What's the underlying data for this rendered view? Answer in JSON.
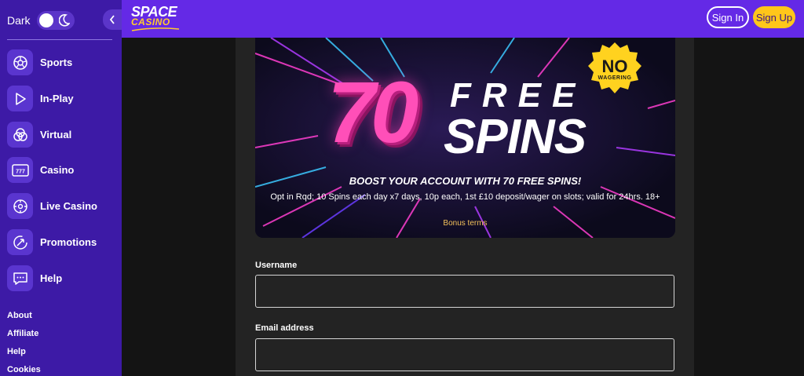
{
  "sidebar": {
    "dark_label": "Dark",
    "theme_toggle": {
      "icon": "moon-icon",
      "enabled": true
    },
    "collapse_icon": "chevron-left-icon",
    "nav_items": [
      {
        "label": "Sports",
        "icon": "sports-ball-icon"
      },
      {
        "label": "In-Play",
        "icon": "play-icon"
      },
      {
        "label": "Virtual",
        "icon": "virtual-icon"
      },
      {
        "label": "Casino",
        "icon": "slot-777-icon"
      },
      {
        "label": "Live Casino",
        "icon": "roulette-icon"
      },
      {
        "label": "Promotions",
        "icon": "promotion-icon"
      },
      {
        "label": "Help",
        "icon": "chat-help-icon"
      }
    ],
    "footer_links": [
      "About",
      "Affiliate",
      "Help",
      "Cookies"
    ]
  },
  "header": {
    "logo_top": "SPACE",
    "logo_bottom": "CASINO",
    "signin_label": "Sign In",
    "signup_label": "Sign Up"
  },
  "banner": {
    "number": "70",
    "free": "FREE",
    "spins": "SPINS",
    "badge_top": "NO",
    "badge_bottom": "WAGERING",
    "headline": "BOOST YOUR ACCOUNT WITH 70 FREE SPINS!",
    "terms": "Opt in Rqd; 10 Spins each day x7 days, 10p each, 1st £10 deposit/wager on slots; valid for 24hrs. 18+",
    "bonus_terms_link": "Bonus terms"
  },
  "form": {
    "username_label": "Username",
    "username_value": "",
    "email_label": "Email address",
    "email_value": ""
  },
  "colors": {
    "sidebar_bg": "#3d1aa6",
    "topbar_bg": "#6429e6",
    "accent_yellow": "#ffc61a",
    "pink": "#ff4fb8"
  }
}
